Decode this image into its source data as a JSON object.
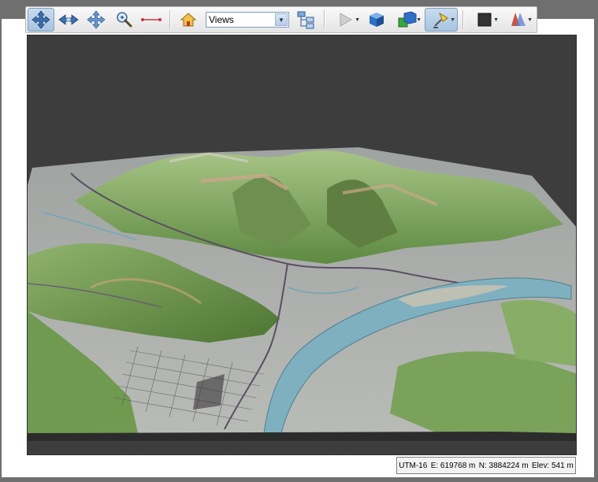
{
  "toolbar": {
    "views_select": {
      "value": "Views"
    },
    "tools": [
      {
        "name": "navigate-tool",
        "active": true
      },
      {
        "name": "fly-tool",
        "active": false
      },
      {
        "name": "pan-tool",
        "active": false
      },
      {
        "name": "zoom-tool",
        "active": false
      },
      {
        "name": "measure-tool",
        "active": false
      }
    ]
  },
  "status_bar": {
    "zone": "UTM-16",
    "easting": "E: 619768 m",
    "northing": "N: 3884224 m",
    "elevation": "Elev: 541 m"
  },
  "colors": {
    "active_button": "#a7c4e2",
    "viewport_bg": "#3d3d3d",
    "river": "#7fb0bf",
    "terrain_green": "#7ea35a"
  }
}
